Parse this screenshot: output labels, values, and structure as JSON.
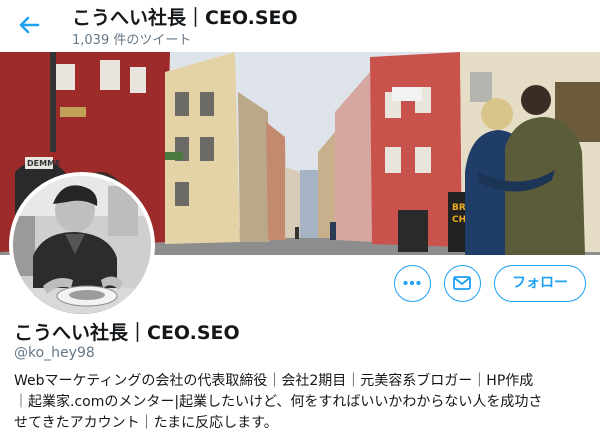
{
  "header": {
    "title": "こうへい社長｜CEO.SEO",
    "tweet_count": "1,039 件のツイート",
    "back_icon": "arrow-left-icon"
  },
  "banner": {
    "shop_sign": "DEMME",
    "sign_lines": [
      "BRA",
      "CHI"
    ]
  },
  "actions": {
    "more_icon": "more-dots-icon",
    "message_icon": "mail-icon",
    "follow_label": "フォロー"
  },
  "profile": {
    "name": "こうへい社長｜CEO.SEO",
    "handle": "@ko_hey98",
    "bio_lines": [
      "Webマーケティングの会社の代表取締役｜会社2期目｜元美容系ブロガー｜HP作成",
      "｜起業家.comのメンター|起業したいけど、何をすればいいかわからない人を成功さ",
      "せてきたアカウント｜たまに反応します。"
    ]
  },
  "colors": {
    "accent": "#1da1f2",
    "text": "#14171a",
    "muted": "#657786"
  }
}
